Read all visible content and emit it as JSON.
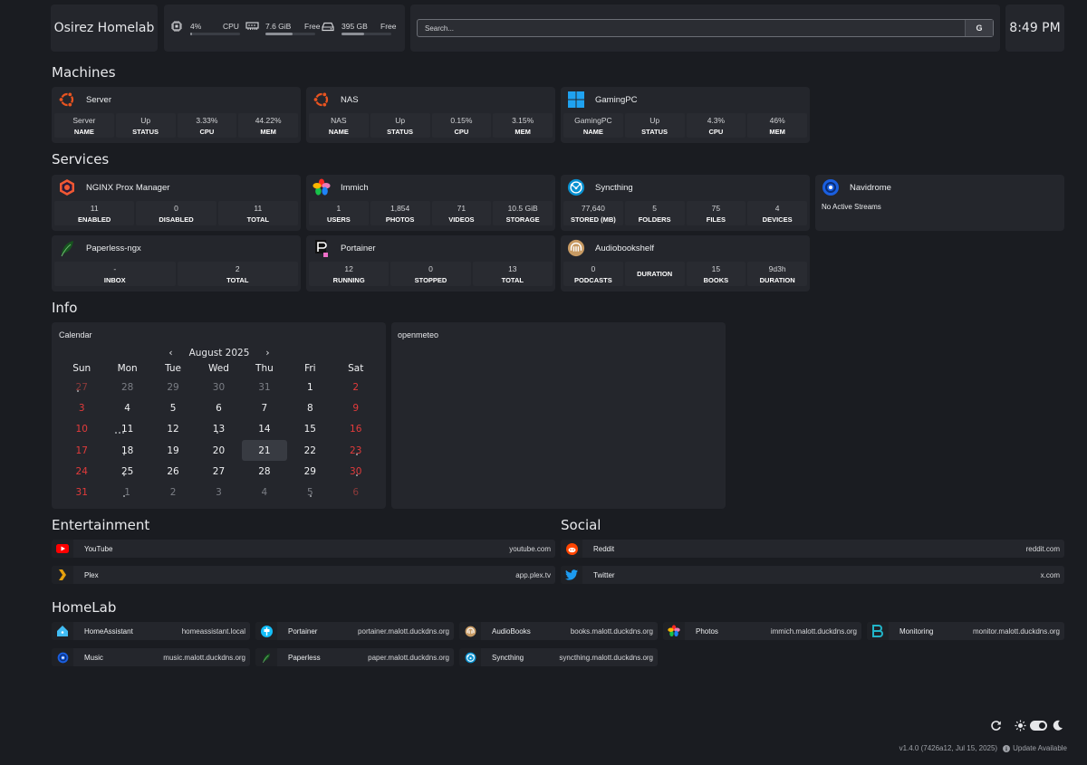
{
  "header": {
    "brand": "Osirez Homelab",
    "resources": {
      "cpu": {
        "value": "4%",
        "label": "CPU",
        "level": 0.04
      },
      "memory": {
        "value": "7.6 GiB",
        "label": "Free",
        "level": 0.55
      },
      "disk": {
        "value": "395 GB",
        "label": "Free",
        "level": 0.45
      }
    },
    "search": {
      "placeholder": "Search...",
      "button": "G"
    },
    "time": "8:49 PM"
  },
  "sections": {
    "machines": "Machines",
    "services": "Services",
    "info": "Info",
    "entertainment": "Entertainment",
    "social": "Social",
    "homelab": "HomeLab"
  },
  "machines": [
    {
      "title": "Server",
      "icon": "ubuntu-icon",
      "stats": [
        {
          "v": "Server",
          "l": "NAME"
        },
        {
          "v": "Up",
          "l": "STATUS"
        },
        {
          "v": "3.33%",
          "l": "CPU"
        },
        {
          "v": "44.22%",
          "l": "MEM"
        }
      ]
    },
    {
      "title": "NAS",
      "icon": "ubuntu-icon",
      "stats": [
        {
          "v": "NAS",
          "l": "NAME"
        },
        {
          "v": "Up",
          "l": "STATUS"
        },
        {
          "v": "0.15%",
          "l": "CPU"
        },
        {
          "v": "3.15%",
          "l": "MEM"
        }
      ]
    },
    {
      "title": "GamingPC",
      "icon": "windows-icon",
      "stats": [
        {
          "v": "GamingPC",
          "l": "NAME"
        },
        {
          "v": "Up",
          "l": "STATUS"
        },
        {
          "v": "4.3%",
          "l": "CPU"
        },
        {
          "v": "46%",
          "l": "MEM"
        }
      ]
    }
  ],
  "services": [
    {
      "title": "NGINX Prox Manager",
      "icon": "nginx-proxy-icon",
      "stats": [
        {
          "v": "11",
          "l": "ENABLED"
        },
        {
          "v": "0",
          "l": "DISABLED"
        },
        {
          "v": "11",
          "l": "TOTAL"
        }
      ]
    },
    {
      "title": "Immich",
      "icon": "immich-icon",
      "stats": [
        {
          "v": "1",
          "l": "USERS"
        },
        {
          "v": "1,854",
          "l": "PHOTOS"
        },
        {
          "v": "71",
          "l": "VIDEOS"
        },
        {
          "v": "10.5 GiB",
          "l": "STORAGE"
        }
      ]
    },
    {
      "title": "Syncthing",
      "icon": "syncthing-icon",
      "stats": [
        {
          "v": "77,640",
          "l": "STORED (MB)"
        },
        {
          "v": "5",
          "l": "FOLDERS"
        },
        {
          "v": "75",
          "l": "FILES"
        },
        {
          "v": "4",
          "l": "DEVICES"
        }
      ]
    },
    {
      "title": "Navidrome",
      "icon": "navidrome-icon",
      "message": "No Active Streams"
    },
    {
      "title": "Paperless-ngx",
      "icon": "paperless-icon",
      "stats": [
        {
          "v": "-",
          "l": "INBOX"
        },
        {
          "v": "2",
          "l": "TOTAL"
        }
      ]
    },
    {
      "title": "Portainer",
      "icon": "portainer-icon",
      "stats": [
        {
          "v": "12",
          "l": "RUNNING"
        },
        {
          "v": "0",
          "l": "STOPPED"
        },
        {
          "v": "13",
          "l": "TOTAL"
        }
      ]
    },
    {
      "title": "Audiobookshelf",
      "icon": "audiobookshelf-icon",
      "stats": [
        {
          "v": "0",
          "l": "PODCASTS"
        },
        {
          "v": "",
          "l": "DURATION"
        },
        {
          "v": "15",
          "l": "BOOKS"
        },
        {
          "v": "9d3h",
          "l": "DURATION"
        }
      ]
    }
  ],
  "calendar": {
    "title": "Calendar",
    "month": "August 2025",
    "prev": "‹",
    "next": "›",
    "weekdays": [
      "Sun",
      "Mon",
      "Tue",
      "Wed",
      "Thu",
      "Fri",
      "Sat"
    ],
    "weeks": [
      [
        "27",
        "28",
        "29",
        "30",
        "31",
        "1",
        "2"
      ],
      [
        "3",
        "4",
        "5",
        "6",
        "7",
        "8",
        "9"
      ],
      [
        "10",
        "11",
        "12",
        "13",
        "14",
        "15",
        "16"
      ],
      [
        "17",
        "18",
        "19",
        "20",
        "21",
        "22",
        "23"
      ],
      [
        "24",
        "25",
        "26",
        "27",
        "28",
        "29",
        "30"
      ],
      [
        "31",
        "1",
        "2",
        "3",
        "4",
        "5",
        "6"
      ]
    ],
    "today": "21"
  },
  "weather": {
    "title": "openmeteo"
  },
  "entertainment": [
    {
      "name": "YouTube",
      "url": "youtube.com",
      "icon": "youtube-icon"
    },
    {
      "name": "Plex",
      "url": "app.plex.tv",
      "icon": "plex-icon"
    }
  ],
  "social": [
    {
      "name": "Reddit",
      "url": "reddit.com",
      "icon": "reddit-icon"
    },
    {
      "name": "Twitter",
      "url": "x.com",
      "icon": "twitter-icon"
    }
  ],
  "homelab": [
    {
      "name": "HomeAssistant",
      "url": "homeassistant.local",
      "icon": "homeassistant-icon"
    },
    {
      "name": "Portainer",
      "url": "portainer.malott.duckdns.org",
      "icon": "portainer-icon"
    },
    {
      "name": "AudioBooks",
      "url": "books.malott.duckdns.org",
      "icon": "audiobookshelf-icon"
    },
    {
      "name": "Photos",
      "url": "immich.malott.duckdns.org",
      "icon": "immich-icon"
    },
    {
      "name": "Monitoring",
      "url": "monitor.malott.duckdns.org",
      "icon": "beszel-icon"
    },
    {
      "name": "Music",
      "url": "music.malott.duckdns.org",
      "icon": "navidrome-icon"
    },
    {
      "name": "Paperless",
      "url": "paper.malott.duckdns.org",
      "icon": "paperless-icon"
    },
    {
      "name": "Syncthing",
      "url": "syncthing.malott.duckdns.org",
      "icon": "syncthing-icon"
    }
  ],
  "footer": {
    "version": "v1.4.0 (7426a12, Jul 15, 2025)",
    "update": "Update Available"
  },
  "colors": {
    "background": "#1a1c21",
    "card": "#24262c",
    "weekend": "#e33b3b"
  }
}
